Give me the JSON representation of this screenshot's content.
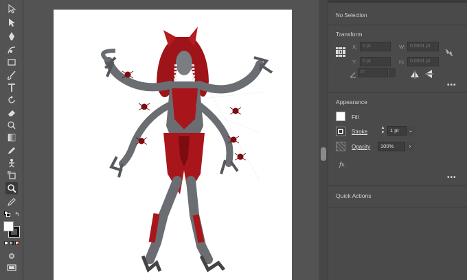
{
  "toolbar": {
    "tools": [
      "selection-tool",
      "direct-selection-tool",
      "pen-tool",
      "curvature-tool",
      "rectangle-tool",
      "paintbrush-tool",
      "type-tool",
      "rotate-tool",
      "eraser-tool",
      "shape-builder-tool",
      "gradient-tool",
      "eyedropper-tool",
      "puppet-warp-tool",
      "artboard-tool",
      "zoom-tool",
      "eyedropper2-tool"
    ]
  },
  "panel": {
    "selection_status": "No Selection",
    "transform": {
      "title": "Transform",
      "x_label": "X:",
      "x_value": "0 pt",
      "y_label": "Y:",
      "y_value": "0 pt",
      "w_label": "W:",
      "w_value": "0.0001 pt",
      "h_label": "H:",
      "h_value": "0.0001 pt",
      "angle_value": "0°"
    },
    "appearance": {
      "title": "Appearance",
      "fill_label": "Fill",
      "stroke_label": "Stroke",
      "stroke_value": "1 pt",
      "opacity_label": "Opacity",
      "opacity_value": "100%",
      "fx_label": "fx."
    },
    "quick_actions": {
      "title": "Quick Actions"
    }
  },
  "colors": {
    "ui_bg": "#535353",
    "panel_bg": "#4a4a4a",
    "artboard": "#ffffff",
    "creature_red": "#a8161b",
    "creature_gray": "#6a6d72"
  }
}
